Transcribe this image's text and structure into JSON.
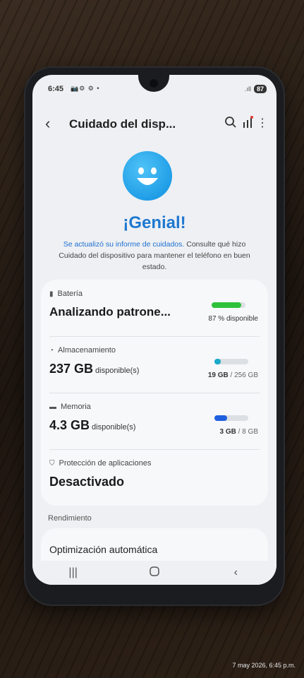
{
  "status_bar": {
    "time": "6:45",
    "notif_icons": "📷⚙ ⚙ •",
    "battery": "87"
  },
  "app_bar": {
    "title": "Cuidado del disp..."
  },
  "hero": {
    "title": "¡Genial!",
    "desc_link": "Se actualizó su informe de cuidados.",
    "desc_rest": " Consulte qué hizo Cuidado del dispositivo para mantener el teléfono en buen estado."
  },
  "items": {
    "battery": {
      "label": "Batería",
      "main": "Analizando patrone...",
      "right": "87 % disponible",
      "level": 87,
      "color": "#2ec23b"
    },
    "storage": {
      "label": "Almacenamiento",
      "value": "237 GB",
      "unit": "disponible(s)",
      "used": "19 GB",
      "total": "/ 256 GB",
      "color": "#1aa9c9"
    },
    "memory": {
      "label": "Memoria",
      "value": "4.3 GB",
      "unit": "disponible(s)",
      "used": "3 GB",
      "total": "/ 8 GB",
      "color": "#1f5fe0"
    },
    "protection": {
      "label": "Protección de aplicaciones",
      "main": "Desactivado"
    }
  },
  "performance": {
    "section": "Rendimiento",
    "item": "Optimización automática"
  },
  "timestamp": "7 may 2026, 6:45 p.m."
}
